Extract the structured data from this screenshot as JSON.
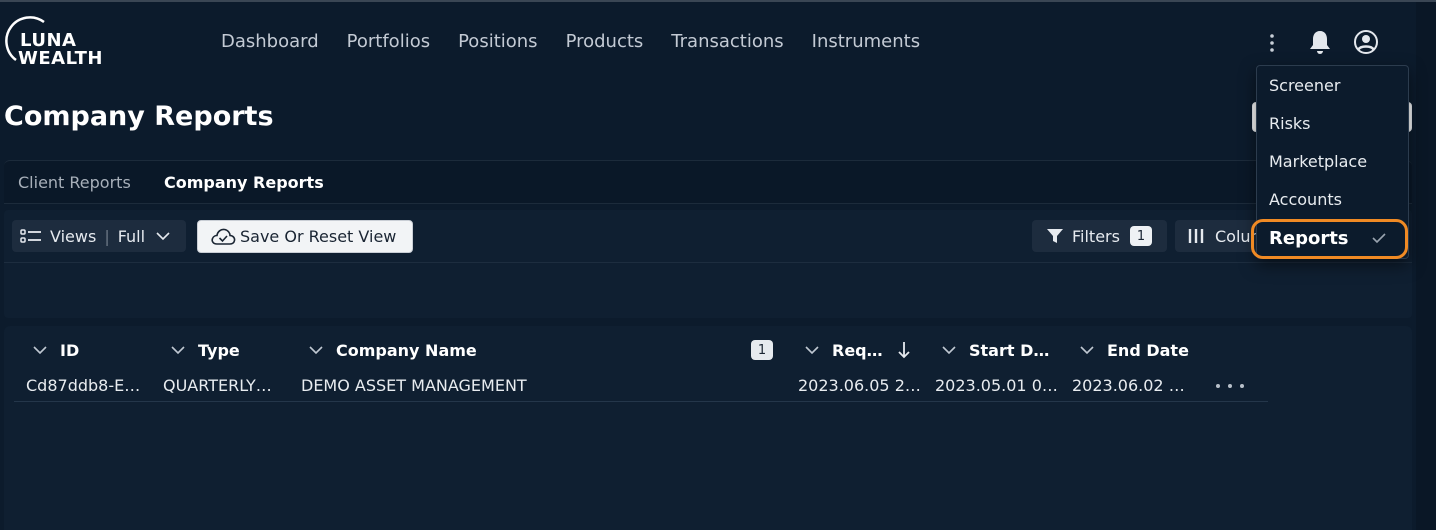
{
  "brand": {
    "line1": "LUNA",
    "line2": "WEALTH"
  },
  "nav": [
    "Dashboard",
    "Portfolios",
    "Positions",
    "Products",
    "Transactions",
    "Instruments"
  ],
  "page": {
    "title": "Company Reports"
  },
  "tabs": [
    "Client Reports",
    "Company Reports"
  ],
  "toolbar": {
    "views_label": "Views",
    "views_value": "Full",
    "save_label": "Save Or Reset View",
    "filters_label": "Filters",
    "filters_count": "1",
    "columns_label": "Columns"
  },
  "grid": {
    "columns": [
      "ID",
      "Type",
      "Company Name",
      "Req…",
      "Start D…",
      "End Date"
    ],
    "sort_count": "1",
    "rows": [
      {
        "id": "Cd87ddb8-E…",
        "type": "QUARTERLY…",
        "company": "DEMO ASSET MANAGEMENT",
        "requested": "2023.06.05 2…",
        "start": "2023.05.01 0…",
        "end": "2023.06.02 …"
      }
    ]
  },
  "menu": {
    "items": [
      "Screener",
      "Risks",
      "Marketplace",
      "Accounts",
      "Reports"
    ],
    "active": "Reports"
  },
  "colors": {
    "background": "#0c1b2c",
    "panel": "#0f1f31",
    "highlight": "#f08a24"
  }
}
